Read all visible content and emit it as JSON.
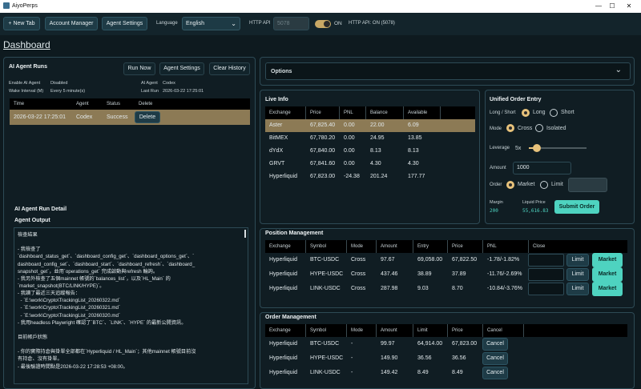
{
  "window": {
    "title": "AiyoPerps",
    "min": "—",
    "max": "☐",
    "close": "✕"
  },
  "toolbar": {
    "new_tab": "+ New Tab",
    "account_manager": "Account Manager",
    "agent_settings": "Agent Settings",
    "language_label": "Language",
    "language_value": "English",
    "http_api_label": "HTTP API",
    "http_api_port": "5078",
    "toggle_state": "ON",
    "http_api_status": "HTTP API: ON (5078)"
  },
  "page_title": "Dashboard",
  "ai_runs": {
    "title": "AI Agent Runs",
    "run_now": "Run Now",
    "agent_settings": "Agent Settings",
    "clear_history": "Clear History",
    "enable_label": "Enable AI Agent",
    "enable_value": "Disabled",
    "wake_label": "Wake Interval (M)",
    "wake_value": "Every 5 minute(s)",
    "agent_label": "AI Agent",
    "agent_value": "Codex",
    "last_run_label": "Last Run",
    "last_run_value": "2026-03-22 17:25:01",
    "columns": [
      "Time",
      "Agent",
      "Status",
      "Delete"
    ],
    "rows": [
      {
        "time": "2026-03-22 17:25:01",
        "agent": "Codex",
        "status": "Success",
        "delete": "Delete"
      }
    ]
  },
  "run_detail": {
    "title": "AI Agent Run Detail",
    "output_label": "Agent Output",
    "lines": [
      "檢查結果",
      "",
      "- 我檢查了",
      "`dashboard_status_get`、`dashboard_config_get`、`dashboard_options_get`、`",
      "dashboard_config_set`、`dashboard_start`、`dashboard_refresh`、`dashboard_",
      "snapshot_get`，並用`operations_get` 完成啟動與refresh 輪詢。",
      "- 我另外檢查了五個mainnet 帳號的`balances_list`，以及`HL_Main` 的",
      "`market_snapshot(BTC/LINK/HYPE)`。",
      "- 我讀了最近三天追蹤報告：",
      "  - `E:\\work\\Crypto\\TrackingList_20260322.md`",
      "  - `E:\\work\\Crypto\\TrackingList_20260321.md`",
      "  - `E:\\work\\Crypto\\TrackingList_20260320.md`",
      "- 我用headless Playwright 確認了`BTC`、`LINK`、`HYPE` 的最新公開資訊。",
      "",
      "目前帳戶狀態",
      "",
      "- 你的實際持倉與掛單全部都在`Hyperliquid / HL_Main`；其他mainnet 帳號目前沒",
      "有持倉、沒有掛單。",
      "- 最後驗證時間點是2026-03-22 17:28:53 +08:00。"
    ]
  },
  "options": {
    "title": "Options",
    "chevron": "⌄"
  },
  "live_info": {
    "title": "Live Info",
    "columns": [
      "Exchange",
      "Price",
      "PNL",
      "Balance",
      "Available"
    ],
    "rows": [
      {
        "exchange": "Aster",
        "price": "67,825.40",
        "pnl": "0.00",
        "balance": "22.00",
        "available": "6.09"
      },
      {
        "exchange": "BitMEX",
        "price": "67,780.20",
        "pnl": "0.00",
        "balance": "24.95",
        "available": "13.85"
      },
      {
        "exchange": "dYdX",
        "price": "67,840.00",
        "pnl": "0.00",
        "balance": "8.13",
        "available": "8.13"
      },
      {
        "exchange": "GRVT",
        "price": "67,841.60",
        "pnl": "0.00",
        "balance": "4.30",
        "available": "4.30"
      },
      {
        "exchange": "Hyperliquid",
        "price": "67,823.00",
        "pnl": "-24.38",
        "balance": "201.24",
        "available": "177.77"
      }
    ]
  },
  "order_entry": {
    "title": "Unified Order Entry",
    "side_label": "Long / Short",
    "long": "Long",
    "short": "Short",
    "mode_label": "Mode",
    "cross": "Cross",
    "isolated": "Isolated",
    "leverage_label": "Leverage",
    "leverage_value": "5x",
    "leverage_fraction": 0.14,
    "amount_label": "Amount",
    "amount_value": "1000",
    "order_label": "Order",
    "market": "Market",
    "limit": "Limit",
    "margin_label": "Margin",
    "margin_value": "200",
    "liq_label": "Liquid Price",
    "liq_value": "55,616.83",
    "submit": "Submit Order"
  },
  "positions": {
    "title": "Position Management",
    "columns": [
      "Exchange",
      "Symbol",
      "Mode",
      "Amount",
      "Entry",
      "Price",
      "PNL",
      "Close"
    ],
    "limit_label": "Limit",
    "market_label": "Market",
    "rows": [
      {
        "exchange": "Hyperliquid",
        "symbol": "BTC-USDC",
        "mode": "Cross",
        "amount": "97.67",
        "entry": "69,058.00",
        "price": "67,822.50",
        "pnl": "-1.78/-1.82%"
      },
      {
        "exchange": "Hyperliquid",
        "symbol": "HYPE-USDC",
        "mode": "Cross",
        "amount": "437.46",
        "entry": "38.89",
        "price": "37.89",
        "pnl": "-11.76/-2.69%"
      },
      {
        "exchange": "Hyperliquid",
        "symbol": "LINK-USDC",
        "mode": "Cross",
        "amount": "287.98",
        "entry": "9.03",
        "price": "8.70",
        "pnl": "-10.84/-3.76%"
      }
    ]
  },
  "orders": {
    "title": "Order Management",
    "columns": [
      "Exchange",
      "Symbol",
      "Mode",
      "Amount",
      "Limit",
      "Price",
      "Cancel"
    ],
    "cancel_label": "Cancel",
    "rows": [
      {
        "exchange": "Hyperliquid",
        "symbol": "BTC-USDC",
        "mode": "-",
        "amount": "99.97",
        "limit": "64,914.00",
        "price": "67,823.00"
      },
      {
        "exchange": "Hyperliquid",
        "symbol": "HYPE-USDC",
        "mode": "-",
        "amount": "149.90",
        "limit": "36.56",
        "price": "36.56"
      },
      {
        "exchange": "Hyperliquid",
        "symbol": "LINK-USDC",
        "mode": "-",
        "amount": "149.42",
        "limit": "8.49",
        "price": "8.49"
      }
    ]
  },
  "colors": {
    "accent": "#4ed3c0",
    "gold": "#e7c27b",
    "selected_row": "#8c7a55"
  }
}
